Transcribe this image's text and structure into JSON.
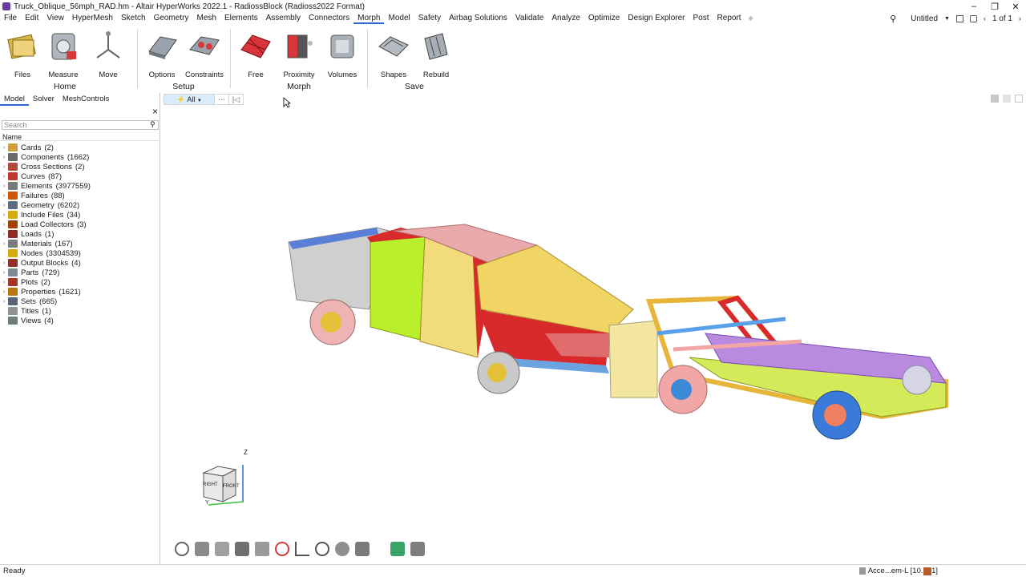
{
  "window": {
    "title": "Truck_Oblique_56mph_RAD.hm - Altair HyperWorks 2022.1 - RadiossBlock (Radioss2022 Format)",
    "minimize": "–",
    "restore": "❐",
    "close": "✕"
  },
  "menu": {
    "items": [
      "File",
      "Edit",
      "View",
      "HyperMesh",
      "Sketch",
      "Geometry",
      "Mesh",
      "Elements",
      "Assembly",
      "Connectors",
      "Morph",
      "Model",
      "Safety",
      "Airbag Solutions",
      "Validate",
      "Analyze",
      "Optimize",
      "Design Explorer",
      "Post",
      "Report"
    ],
    "active_index": 10,
    "session_name": "Untitled",
    "page_indicator": "1 of 1"
  },
  "ribbon": {
    "tools": [
      {
        "label": "Files",
        "icon": "files-icon"
      },
      {
        "label": "Measure",
        "icon": "measure-icon"
      },
      {
        "label": "Move",
        "icon": "move-icon"
      },
      {
        "label": "Options",
        "icon": "options-icon"
      },
      {
        "label": "Constraints",
        "icon": "constraints-icon"
      },
      {
        "label": "Free",
        "icon": "free-morph-icon"
      },
      {
        "label": "Proximity",
        "icon": "proximity-icon"
      },
      {
        "label": "Volumes",
        "icon": "volumes-icon"
      },
      {
        "label": "Shapes",
        "icon": "shapes-icon"
      },
      {
        "label": "Rebuild",
        "icon": "rebuild-icon"
      }
    ],
    "groups": [
      "Home",
      "Setup",
      "Morph",
      "Save"
    ]
  },
  "browser": {
    "tabs": [
      "Model",
      "Solver",
      "MeshControls"
    ],
    "active_tab": 0,
    "search_placeholder": "Search",
    "column_name": "Name",
    "close": "×",
    "items": [
      {
        "label": "Cards",
        "count": "(2)",
        "color": "#c9a23a"
      },
      {
        "label": "Components",
        "count": "(1662)",
        "color": "#6b6b6b"
      },
      {
        "label": "Cross Sections",
        "count": "(2)",
        "color": "#b04a3a"
      },
      {
        "label": "Curves",
        "count": "(87)",
        "color": "#c0392b"
      },
      {
        "label": "Elements",
        "count": "(3977559)",
        "color": "#7a7a7a"
      },
      {
        "label": "Failures",
        "count": "(88)",
        "color": "#d35400"
      },
      {
        "label": "Geometry",
        "count": "(6202)",
        "color": "#5d6d7e"
      },
      {
        "label": "Include Files",
        "count": "(34)",
        "color": "#d4ac0d"
      },
      {
        "label": "Load Collectors",
        "count": "(3)",
        "color": "#a04000"
      },
      {
        "label": "Loads",
        "count": "(1)",
        "color": "#922b21"
      },
      {
        "label": "Materials",
        "count": "(167)",
        "color": "#7b7d7d"
      },
      {
        "label": "Nodes",
        "count": "(3304539)",
        "color": "#d4ac0d"
      },
      {
        "label": "Output Blocks",
        "count": "(4)",
        "color": "#943126"
      },
      {
        "label": "Parts",
        "count": "(729)",
        "color": "#808b96"
      },
      {
        "label": "Plots",
        "count": "(2)",
        "color": "#a93226"
      },
      {
        "label": "Properties",
        "count": "(1621)",
        "color": "#b9770e"
      },
      {
        "label": "Sets",
        "count": "(665)",
        "color": "#566573"
      },
      {
        "label": "Titles",
        "count": "(1)",
        "color": "#909497"
      },
      {
        "label": "Views",
        "count": "(4)",
        "color": "#707b7c"
      }
    ]
  },
  "viewport": {
    "filter_label": "All",
    "filter_more": "···",
    "view_cube_faces": [
      "RIGHT",
      "FRONT"
    ],
    "axis_label_z": "Z",
    "axis_label_y": "Y"
  },
  "status": {
    "left": "Ready",
    "include": "Acce...em-L [10...01]"
  },
  "colors": {
    "accent": "#2a6ad1",
    "filter_bg": "#d9ecfb"
  }
}
